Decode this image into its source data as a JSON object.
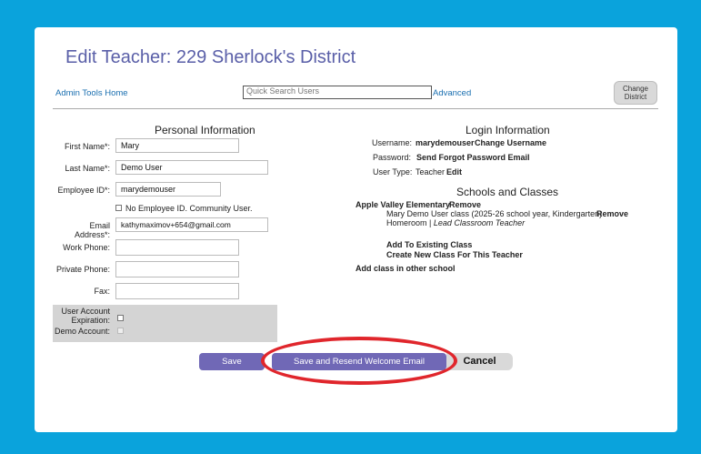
{
  "page": {
    "title": "Edit Teacher: 229 Sherlock's District"
  },
  "toolbar": {
    "admin_home": "Admin Tools Home",
    "search_placeholder": "Quick Search Users",
    "advanced": "Advanced",
    "change_district_line1": "Change",
    "change_district_line2": "District"
  },
  "personal": {
    "heading": "Personal Information",
    "first_name_label": "First Name*:",
    "first_name": "Mary",
    "last_name_label": "Last Name*:",
    "last_name": "Demo User",
    "employee_id_label": "Employee ID*:",
    "employee_id": "marydemouser",
    "no_employee_id": "No Employee ID. Community User.",
    "email_label": "Email Address*:",
    "email": "kathymaximov+654@gmail.com",
    "work_phone_label": "Work Phone:",
    "work_phone": "",
    "private_phone_label": "Private Phone:",
    "private_phone": "",
    "fax_label": "Fax:",
    "fax": "",
    "expiration_label_1": "User Account",
    "expiration_label_2": "Expiration:",
    "demo_account_label": "Demo Account:"
  },
  "login": {
    "heading": "Login Information",
    "username_label": "Username:",
    "username": "marydemouser",
    "change_username": "Change Username",
    "password_label": "Password:",
    "send_forgot": "Send Forgot Password Email",
    "user_type_label": "User Type:",
    "user_type": "Teacher",
    "edit": "Edit"
  },
  "schools": {
    "heading": "Schools and Classes",
    "school_name": "Apple Valley Elementary",
    "remove": "Remove",
    "class_desc": "Mary Demo User class (2025-26 school year, Kindergarten)",
    "class_remove": "Remove",
    "class_role_prefix": "Homeroom |",
    "class_role": "Lead Classroom Teacher",
    "add_existing": "Add To Existing Class",
    "create_new": "Create New Class For This Teacher",
    "add_other": "Add class in other school"
  },
  "actions": {
    "save": "Save",
    "save_resend": "Save and Resend Welcome Email",
    "cancel": "Cancel"
  },
  "colors": {
    "background": "#0aa3dc",
    "title": "#5a5fa8",
    "link": "#1a7fb5",
    "button": "#7068b6",
    "annotation": "#e0262c"
  }
}
